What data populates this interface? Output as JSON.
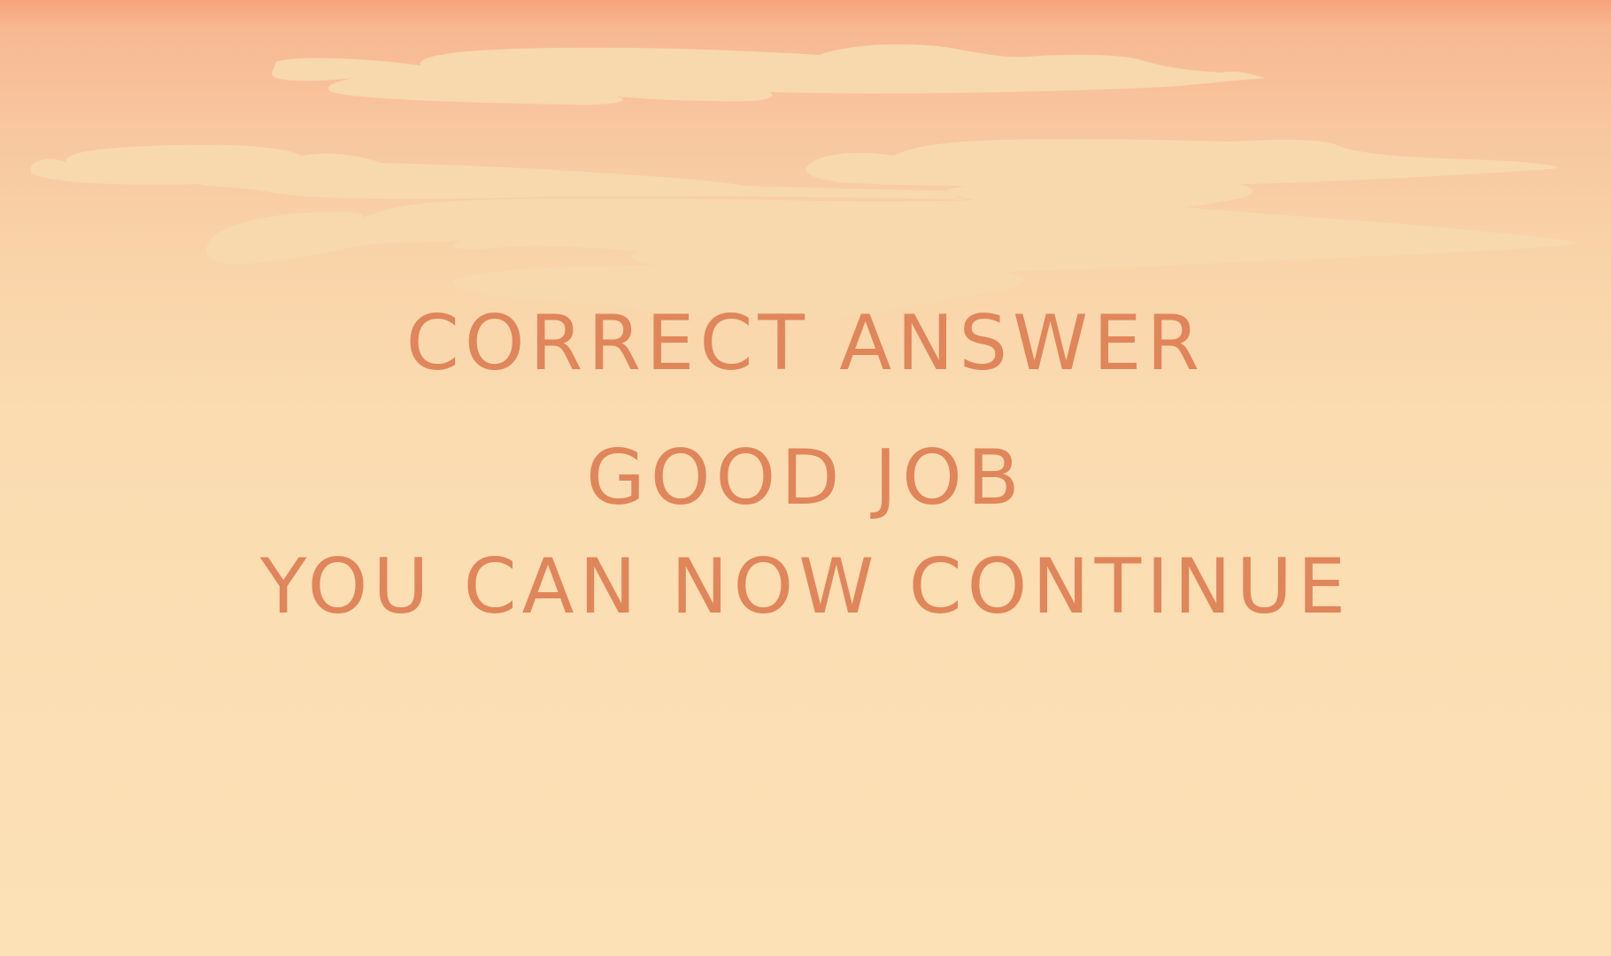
{
  "screen": {
    "name": "correct-answer-screen",
    "background_colors": {
      "sky_top": "#f5a47c",
      "sky_bottom": "#fce1b6",
      "cloud": "#f8d8ad",
      "text": "#e0865a"
    }
  },
  "message": {
    "line1": "CORRECT ANSWER",
    "line2": "GOOD JOB",
    "line3": "YOU CAN NOW CONTINUE"
  }
}
